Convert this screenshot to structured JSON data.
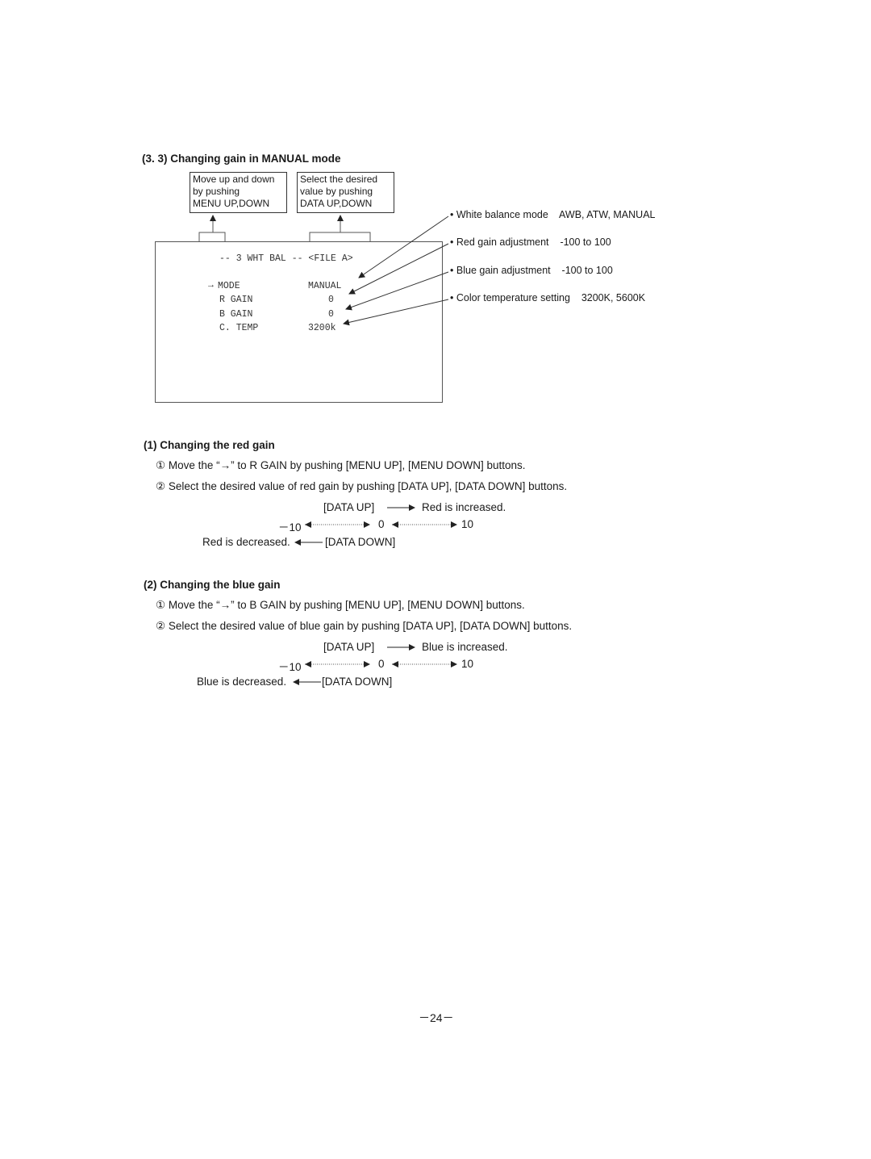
{
  "section": {
    "number": "(3. 3)",
    "title": "Changing gain in MANUAL mode"
  },
  "callouts": {
    "menu_box": [
      "Move up and down",
      "by pushing",
      "MENU UP,DOWN"
    ],
    "data_box": [
      "Select the desired",
      "value by pushing",
      "DATA UP,DOWN"
    ]
  },
  "screen": {
    "header": "--  3  WHT BAL --  <FILE A>",
    "cursor": "→",
    "rows": [
      {
        "label": "MODE",
        "value": "MANUAL"
      },
      {
        "label": "R GAIN",
        "value": "0"
      },
      {
        "label": "B GAIN",
        "value": "0"
      },
      {
        "label": "C. TEMP",
        "value": "3200k"
      }
    ]
  },
  "notes": [
    {
      "bullet": "•",
      "label": "White balance mode",
      "range": "AWB, ATW, MANUAL"
    },
    {
      "bullet": "•",
      "label": "Red gain adjustment",
      "range": "-100 to 100"
    },
    {
      "bullet": "•",
      "label": "Blue gain adjustment",
      "range": "-100 to 100"
    },
    {
      "bullet": "•",
      "label": "Color temperature setting",
      "range": "3200K, 5600K"
    }
  ],
  "red": {
    "heading": "(1) Changing the red gain",
    "steps": [
      {
        "marker": "①",
        "text": "Move the “→” to R GAIN by pushing [MENU UP], [MENU DOWN] buttons."
      },
      {
        "marker": "②",
        "text": "Select the desired value of red gain by pushing [DATA UP], [DATA DOWN] buttons."
      }
    ],
    "diagram": {
      "data_up": "[DATA UP]",
      "increased": "Red is increased.",
      "min": "－10",
      "mid": "0",
      "max": "10",
      "decreased": "Red is decreased.",
      "data_down": "[DATA DOWN]"
    }
  },
  "blue": {
    "heading": "(2) Changing the blue gain",
    "steps": [
      {
        "marker": "①",
        "text": "Move the “→” to B GAIN by pushing [MENU UP], [MENU DOWN] buttons."
      },
      {
        "marker": "②",
        "text": "Select the desired value of blue gain by pushing [DATA UP], [DATA DOWN] buttons."
      }
    ],
    "diagram": {
      "data_up": "[DATA UP]",
      "increased": "Blue is increased.",
      "min": "－10",
      "mid": "0",
      "max": "10",
      "decreased": "Blue is decreased.",
      "data_down": "[DATA DOWN]"
    }
  },
  "page_number": "－24－"
}
